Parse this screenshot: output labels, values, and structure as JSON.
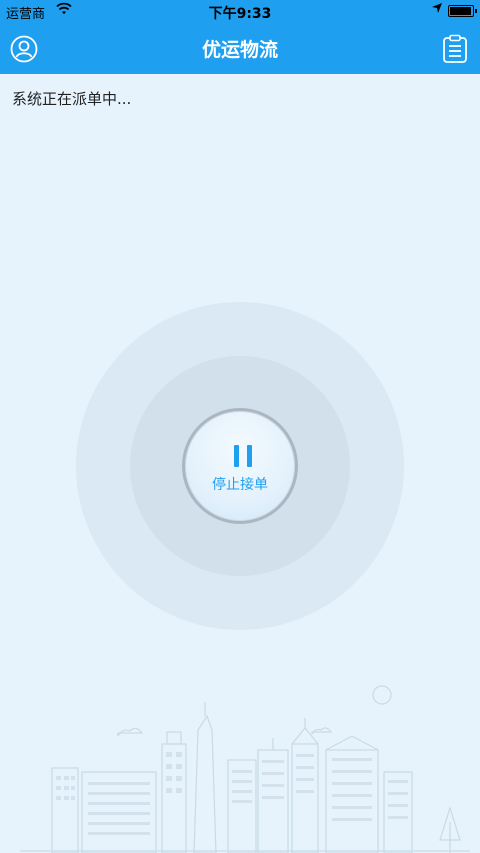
{
  "status_bar": {
    "carrier": "运营商",
    "time": "下午9:33"
  },
  "nav": {
    "title": "优运物流",
    "left_icon": "user-profile-icon",
    "right_icon": "order-list-icon"
  },
  "main": {
    "status_message": "系统正在派单中...",
    "stop_button_label": "停止接单",
    "stop_button_icon": "pause-icon"
  },
  "colors": {
    "primary": "#1e9ff0",
    "background": "#e6f3fd"
  }
}
